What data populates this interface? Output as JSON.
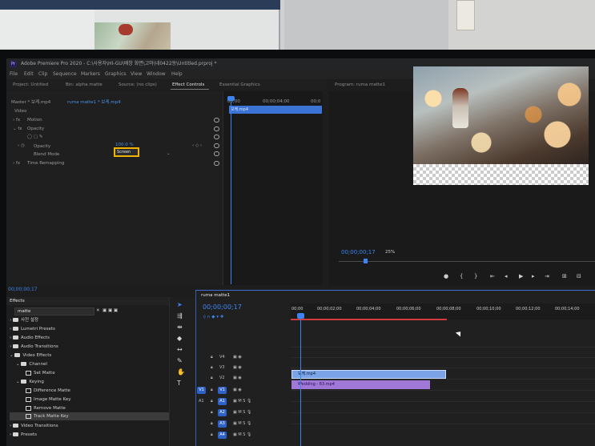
{
  "window": {
    "badge": "Pr",
    "title": "Adobe Premiere Pro 2020 - C:\\사용자\\HI-GU\\배창 화면\\고마\\네0422동\\Untitled.prproj *"
  },
  "menu": [
    "File",
    "Edit",
    "Clip",
    "Sequence",
    "Markers",
    "Graphics",
    "View",
    "Window",
    "Help"
  ],
  "panel_tabs": {
    "project": "Project: Untitled",
    "bin": "Bin: alpha matte",
    "source": "Source: (no clips)",
    "effect_controls": "Effect Controls",
    "essential_graphics": "Essential Graphics",
    "program": "Program: ruma matte1"
  },
  "effect_controls": {
    "master": "Master * 보케.mp4",
    "sequence": "ruma matte1 * 보케.mp4",
    "section_video": "Video",
    "motion": "Motion",
    "opacity": "Opacity",
    "opacity_prop": "Opacity",
    "opacity_value": "100.0 %",
    "blend_mode_label": "Blend Mode",
    "blend_mode_value": "Screen",
    "time_remapping": "Time Remapping",
    "ruler_start": "00;00",
    "ruler_mid": "00;00;04;00",
    "ruler_end": "00;0",
    "clip_label": "보케.mp4",
    "timecode": "00;00;00;17"
  },
  "program": {
    "timecode": "00;00;00;17",
    "zoom": "25%"
  },
  "effects_panel": {
    "title": "Effects",
    "search": "matte",
    "items": [
      "사전 설정",
      "Lumetri Presets",
      "Audio Effects",
      "Audio Transitions",
      "Video Effects",
      "Channel",
      "Set Matte",
      "Keying",
      "Difference Matte",
      "Image Matte Key",
      "Remove Matte",
      "Track Matte Key",
      "Video Transitions",
      "Presets"
    ]
  },
  "timeline": {
    "tab": "ruma matte1",
    "timecode": "00;00;00;17",
    "ruler": [
      "00;00",
      "00;00;02;00",
      "00;00;04;00",
      "00;00;06;00",
      "00;00;08;00",
      "00;00;10;00",
      "00;00;12;00",
      "00;00;14;00"
    ],
    "tracks_video": [
      "V4",
      "V3",
      "V2",
      "V1"
    ],
    "tracks_audio": [
      "A1",
      "A2",
      "A3",
      "A4"
    ],
    "source_v1": "V1",
    "source_a1": "A1",
    "clip_v2": "보케.mp4",
    "clip_v1": "Wedding - 63.mp4"
  },
  "colors": {
    "accent_blue": "#3d84f2",
    "highlight_box": "#f0b400",
    "clip_v2": "#7aa3e8",
    "clip_v1": "#9f78d8"
  }
}
